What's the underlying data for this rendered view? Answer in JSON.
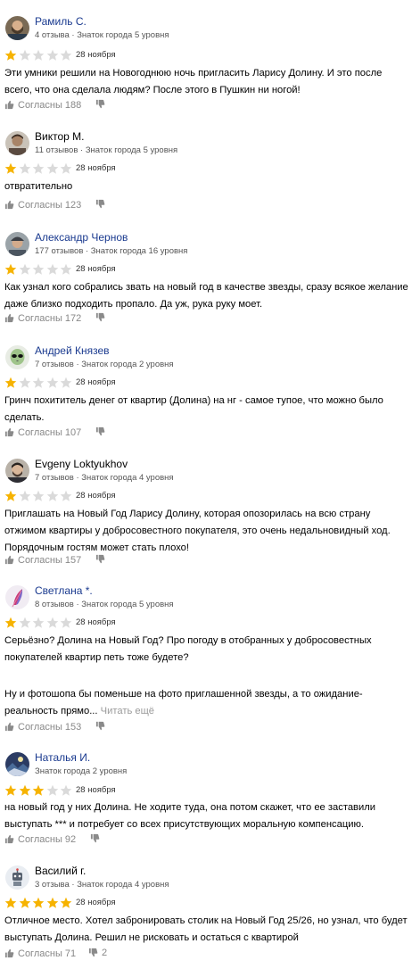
{
  "star_color_filled": "#f6b300",
  "star_color_empty": "#dadada",
  "name_color": "#1a3a8f",
  "reviews": [
    {
      "name": "Рамиль С.",
      "meta": "4 отзыва · Знаток города 5 уровня",
      "avatar": "avatar-photo-man-bearded",
      "rating": 1,
      "date": "28 ноября",
      "text": "Эти умники решили на Новогоднюю ночь пригласить Ларису Долину. И это после всего, что она сделала людям? После этого в Пушкин ни ногой!",
      "agree": "Согласны 188",
      "dislikes": ""
    },
    {
      "name": "Виктор М.",
      "meta": "11 отзывов · Знаток города 5 уровня",
      "avatar": "avatar-photo-man",
      "rating": 1,
      "date": "28 ноября",
      "text": "отвратительно",
      "agree": "Согласны 123",
      "dislikes": ""
    },
    {
      "name": "Александр Чернов",
      "meta": "177 отзывов · Знаток города 16 уровня",
      "avatar": "avatar-photo-man-cap",
      "rating": 1,
      "date": "28 ноября",
      "text": "Как узнал кого собрались звать на новый год в качестве звезды, сразу всякое желание даже близко подходить пропало. Да уж, рука руку моет.",
      "agree": "Согласны 172",
      "dislikes": ""
    },
    {
      "name": "Андрей Князев",
      "meta": "7 отзывов · Знаток города 2 уровня",
      "avatar": "avatar-alien",
      "rating": 1,
      "date": "28 ноября",
      "text": "Гринч похититель денег от квартир (Долина) на нг - самое тупое, что можно было сделать.",
      "agree": "Согласны 107",
      "dislikes": ""
    },
    {
      "name": "Evgeny Loktyukhov",
      "meta": "7 отзывов · Знаток города 4 уровня",
      "avatar": "avatar-photo-man-glasses",
      "rating": 1,
      "date": "28 ноября",
      "text": "Приглашать на Новый Год Ларису Долину, которая опозорилась на всю страну отжимом квартиры у добросовестного покупателя, это очень недальновидный ход. Порядочным гостям может стать плохо!",
      "agree": "Согласны 157",
      "dislikes": ""
    },
    {
      "name": "Светлана *.",
      "meta": "8 отзывов · Знаток города 5 уровня",
      "avatar": "avatar-feather",
      "rating": 1,
      "date": "28 ноября",
      "text": "Серьёзно? Долина на Новый Год? Про погоду в отобранных у добросовестных покупателей квартир петь тоже будете?",
      "text2": "Ну и фотошопа бы поменьше на фото приглашенной звезды, а то ожидание-реальность прямо...",
      "more": "Читать ещё",
      "agree": "Согласны 153",
      "dislikes": ""
    },
    {
      "name": "Наталья И.",
      "meta": "Знаток города 2 уровня",
      "avatar": "avatar-photo-landscape",
      "rating": 3,
      "date": "28 ноября",
      "text": "на новый год у них Долина. Не ходите туда, она потом скажет, что ее заставили выступать *** и потребует со всех присутствующих моральную компенсацию.",
      "agree": "Согласны 92",
      "dislikes": ""
    },
    {
      "name": "Василий г.",
      "meta": "3 отзыва · Знаток города 4 уровня",
      "avatar": "avatar-robot",
      "rating": 5,
      "date": "28 ноября",
      "text": "Отличное место. Хотел забронировать столик на Новый Год 25/26, но узнал, что будет выступать Долина. Решил не рисковать и остаться с квартирой",
      "agree": "Согласны 71",
      "dislikes": "2"
    }
  ]
}
